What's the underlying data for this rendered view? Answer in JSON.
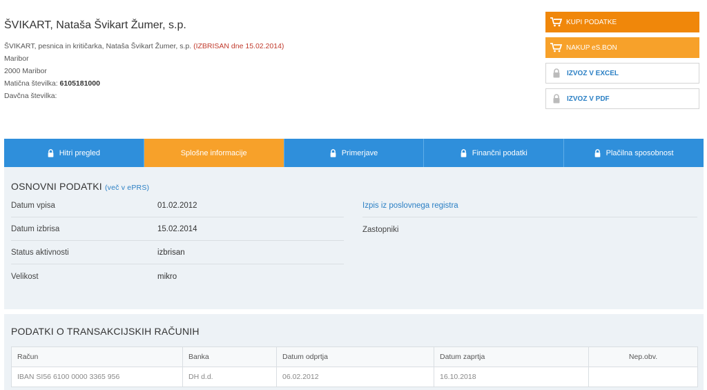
{
  "company": {
    "name": "ŠVIKART, Nataša Švikart Žumer, s.p.",
    "full_name": "ŠVIKART, pesnica in kritičarka, Nataša Švikart Žumer, s.p.",
    "status_note": "(IZBRISAN dne 15.02.2014)",
    "city": "Maribor",
    "postal": "2000 Maribor",
    "reg_label": "Matična številka:",
    "reg_number": "6105181000",
    "tax_label": "Davčna številka:"
  },
  "actions": {
    "buy": "KUPI PODATKE",
    "bon": "NAKUP eS.BON",
    "excel": "IZVOZ V EXCEL",
    "pdf": "IZVOZ V PDF"
  },
  "tabs": [
    {
      "label": "Hitri pregled",
      "locked": true
    },
    {
      "label": "Splošne informacije",
      "locked": false,
      "active": true
    },
    {
      "label": "Primerjave",
      "locked": true
    },
    {
      "label": "Finančni podatki",
      "locked": true
    },
    {
      "label": "Plačilna sposobnost",
      "locked": true
    }
  ],
  "basic": {
    "title": "OSNOVNI PODATKI",
    "link": "(več v ePRS)",
    "rows": [
      {
        "label": "Datum vpisa",
        "value": "01.02.2012"
      },
      {
        "label": "Datum izbrisa",
        "value": "15.02.2014"
      },
      {
        "label": "Status aktivnosti",
        "value": "izbrisan"
      },
      {
        "label": "Velikost",
        "value": "mikro"
      }
    ],
    "register_link": "Izpis iz poslovnega registra",
    "agents_label": "Zastopniki"
  },
  "transactions": {
    "title": "PODATKI O TRANSAKCIJSKIH RAČUNIH",
    "columns": [
      "Račun",
      "Banka",
      "Datum odprtja",
      "Datum zaprtja",
      "Nep.obv."
    ],
    "rows": [
      [
        "IBAN SI56 6100 0000 3365 956",
        "DH d.d.",
        "06.02.2012",
        "16.10.2018",
        ""
      ]
    ]
  },
  "colors": {
    "primary_blue": "#2f8fdb",
    "accent_orange": "#f7a12a",
    "buy_orange": "#f0870a",
    "status_red": "#c0392b"
  }
}
